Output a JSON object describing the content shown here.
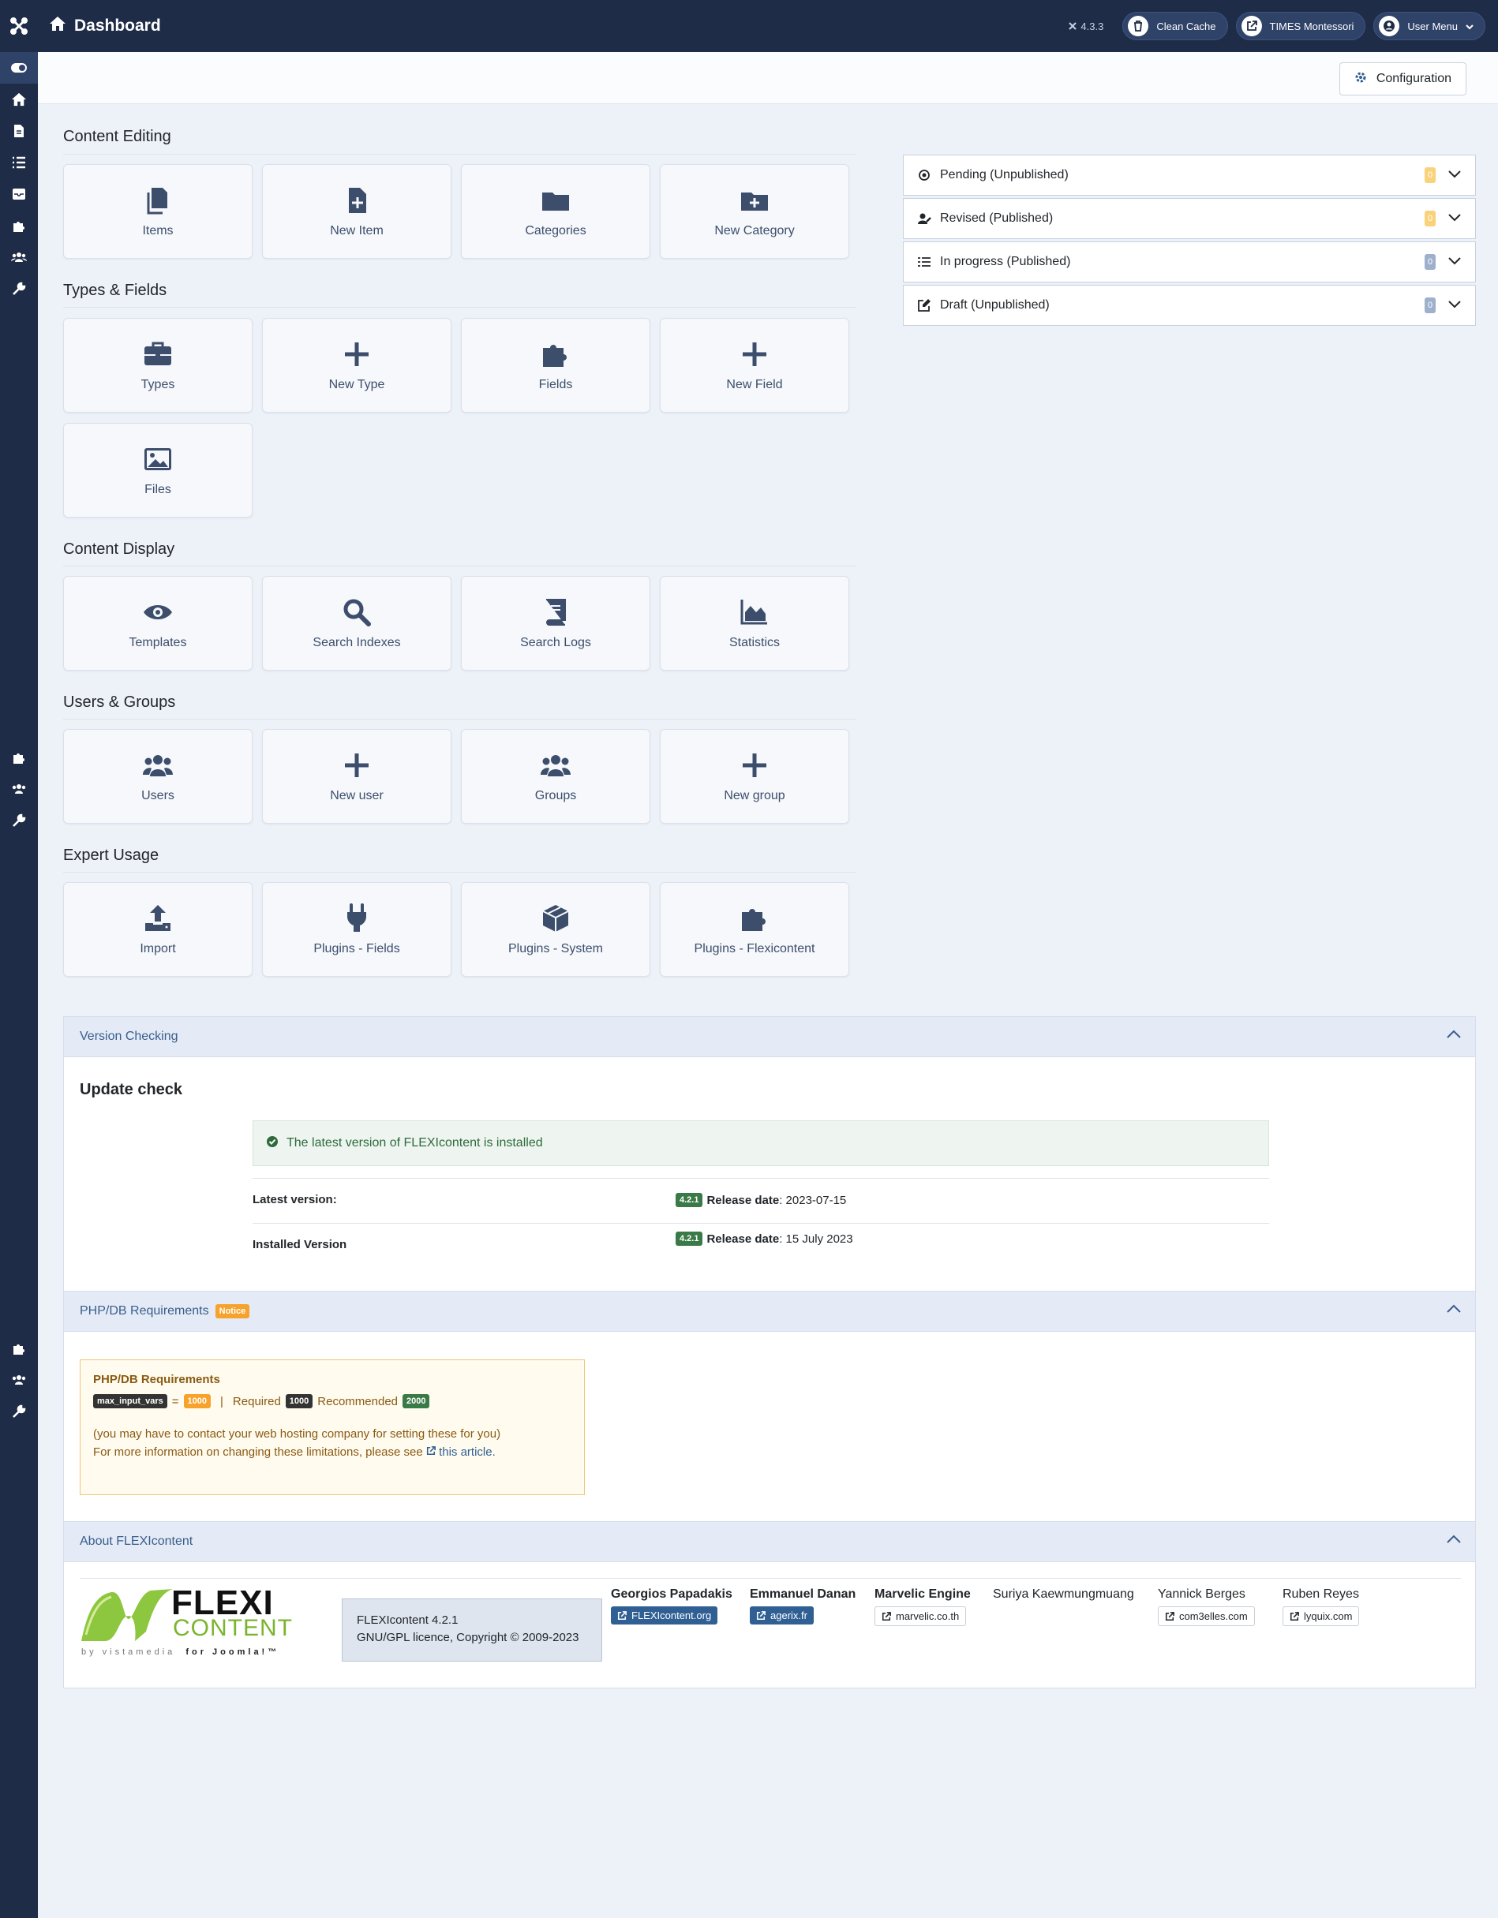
{
  "header": {
    "title": "Dashboard",
    "version": "4.3.3",
    "buttons": [
      {
        "label": "Clean Cache",
        "icon": "trash-icon"
      },
      {
        "label": "TIMES Montessori",
        "icon": "external-link-icon"
      },
      {
        "label": "User Menu",
        "icon": "user-icon"
      }
    ]
  },
  "toolbar": {
    "config_label": "Configuration"
  },
  "sections": {
    "content_editing": {
      "title": "Content Editing",
      "tiles": [
        "Items",
        "New Item",
        "Categories",
        "New Category"
      ]
    },
    "types_fields": {
      "title": "Types & Fields",
      "tiles": [
        "Types",
        "New Type",
        "Fields",
        "New Field",
        "Files"
      ]
    },
    "content_display": {
      "title": "Content Display",
      "tiles": [
        "Templates",
        "Search Indexes",
        "Search Logs",
        "Statistics"
      ]
    },
    "users_groups": {
      "title": "Users & Groups",
      "tiles": [
        "Users",
        "New user",
        "Groups",
        "New group"
      ]
    },
    "expert": {
      "title": "Expert Usage",
      "tiles": [
        "Import",
        "Plugins - Fields",
        "Plugins - System",
        "Plugins - Flexicontent"
      ]
    }
  },
  "status": [
    {
      "label": "Pending (Unpublished)",
      "count": "0",
      "color": "#f9d27a"
    },
    {
      "label": "Revised (Published)",
      "count": "0",
      "color": "#f9d27a"
    },
    {
      "label": "In progress (Published)",
      "count": "0",
      "color": "#9fb0cc"
    },
    {
      "label": "Draft (Unpublished)",
      "count": "0",
      "color": "#9fb0cc"
    }
  ],
  "version_check": {
    "heading": "Version Checking",
    "title": "Update check",
    "message": "The latest version of FLEXIcontent is installed",
    "latest_label": "Latest version:",
    "installed_label": "Installed Version",
    "latest_version": "4.2.1",
    "installed_version": "4.2.1",
    "release_label": "Release date",
    "latest_date": ": 2023-07-15",
    "installed_date": ": 15 July 2023"
  },
  "requirements": {
    "heading": "PHP/DB Requirements",
    "notice": "Notice",
    "box_title": "PHP/DB Requirements",
    "var_name": "max_input_vars",
    "eq": "=",
    "current": "1000",
    "sep": "|",
    "required_label": "Required",
    "required": "1000",
    "recommended_label": "Recommended",
    "recommended": "2000",
    "line1": "(you may have to contact your web hosting company for setting these for you)",
    "line2": "For more information on changing these limitations, please see",
    "link": "this article."
  },
  "about": {
    "heading": "About FLEXIcontent",
    "logo_word1": "FLEXI",
    "logo_word2": "CONTENT",
    "logo_sub": "by vistamedia",
    "logo_sub2": "for Joomla!™",
    "product": "FLEXIcontent 4.2.1",
    "licence": "GNU/GPL licence, Copyright © 2009-2023",
    "credits": [
      {
        "name": "Georgios Papadakis",
        "link": "FLEXIcontent.org",
        "style": "blue"
      },
      {
        "name": "Emmanuel Danan",
        "link": "agerix.fr",
        "style": "blue"
      },
      {
        "name": "Marvelic Engine",
        "link": "marvelic.co.th",
        "style": "white"
      },
      {
        "name": "Suriya Kaewmungmuang",
        "link": "",
        "style": "none"
      },
      {
        "name": "Yannick Berges",
        "link": "com3elles.com",
        "style": "white"
      },
      {
        "name": "Ruben Reyes",
        "link": "lyquix.com",
        "style": "white"
      }
    ]
  },
  "colors": {
    "header_bg": "#1f2c47",
    "icon_color": "#3c4e6c",
    "page_bg": "#edf1f8"
  }
}
